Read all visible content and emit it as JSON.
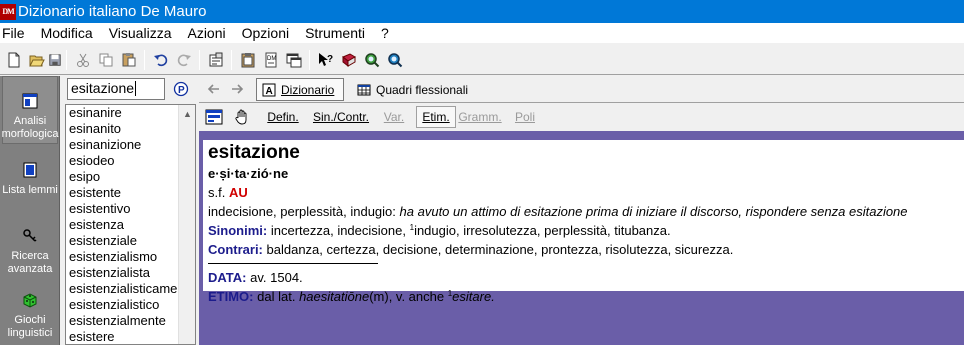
{
  "window": {
    "icon_text": "DM",
    "title": "Dizionario italiano De Mauro"
  },
  "menu": [
    "File",
    "Modifica",
    "Visualizza",
    "Azioni",
    "Opzioni",
    "Strumenti",
    "?"
  ],
  "toolbar": {
    "icons": [
      "new-icon",
      "open-icon",
      "save-icon",
      "cut-icon",
      "copy-icon",
      "paste-icon",
      "undo-icon",
      "redo-icon",
      "properties-icon",
      "clipboard-icon",
      "dictionary-icon",
      "window-icon",
      "help-pointer-icon",
      "book-icon",
      "search-icon",
      "search-advanced-icon"
    ]
  },
  "sidebar": {
    "items": [
      {
        "label": "Analisi morfologica",
        "icon": "analysis-icon"
      },
      {
        "label": "Lista lemmi",
        "icon": "list-icon"
      },
      {
        "label": "Ricerca avanzata",
        "icon": "search-key-icon"
      },
      {
        "label": "Giochi linguistici",
        "icon": "dice-icon"
      }
    ]
  },
  "search": {
    "value": "esitazione"
  },
  "wordlist": {
    "items": [
      "esinanire",
      "esinanito",
      "esinanizione",
      "esiodeo",
      "esipo",
      "esistente",
      "esistentivo",
      "esistenza",
      "esistenziale",
      "esistenzialismo",
      "esistenzialista",
      "esistenzialisticamente",
      "esistenzialistico",
      "esistenzialmente",
      "esistere"
    ]
  },
  "nav": {
    "tab_dizionario": "Dizionario",
    "tab_quadri": "Quadri flessionali"
  },
  "view_tabs": [
    {
      "label": "Defin.",
      "state": "normal"
    },
    {
      "label": "Sin./Contr.",
      "state": "normal"
    },
    {
      "label": "Var.",
      "state": "disabled"
    },
    {
      "label": "Etim.",
      "state": "selected"
    },
    {
      "label": "Gramm.",
      "state": "disabled"
    },
    {
      "label": "Poli",
      "state": "disabled"
    }
  ],
  "entry": {
    "headword": "esitazione",
    "syllabation": "e·ṣi·ta·zió·ne",
    "gram_cat": "s.f.",
    "usage_mark": "AU",
    "definition": "indecisione, perplessità, indugio:",
    "example": "ha avuto un attimo di esitazione prima di iniziare il discorso, rispondere senza esitazione",
    "synonyms_label": "Sinonimi:",
    "synonyms_pre": "incertezza, indecisione,",
    "synonyms_sup": "1",
    "synonyms_post": "indugio, irresolutezza, perplessità, titubanza.",
    "contrari_label": "Contrari:",
    "contrari": "baldanza, certezza, decisione, determinazione, prontezza, risolutezza, sicurezza.",
    "data_label": "DATA:",
    "data": "av. 1504.",
    "etimo_label": "ETIMO:",
    "etimo_pre": "dal lat.",
    "etimo_word": "haesitatiōne",
    "etimo_paren": "(m)",
    "etimo_mid": ", v. anche",
    "etimo_sup": "1",
    "etimo_ref": "esitare."
  },
  "colors": {
    "titlebar": "#0078d7",
    "sidebar": "#808080",
    "entry_frame": "#6a5ea8",
    "label_blue": "#1c1c8c",
    "usage_red": "#d00000"
  }
}
